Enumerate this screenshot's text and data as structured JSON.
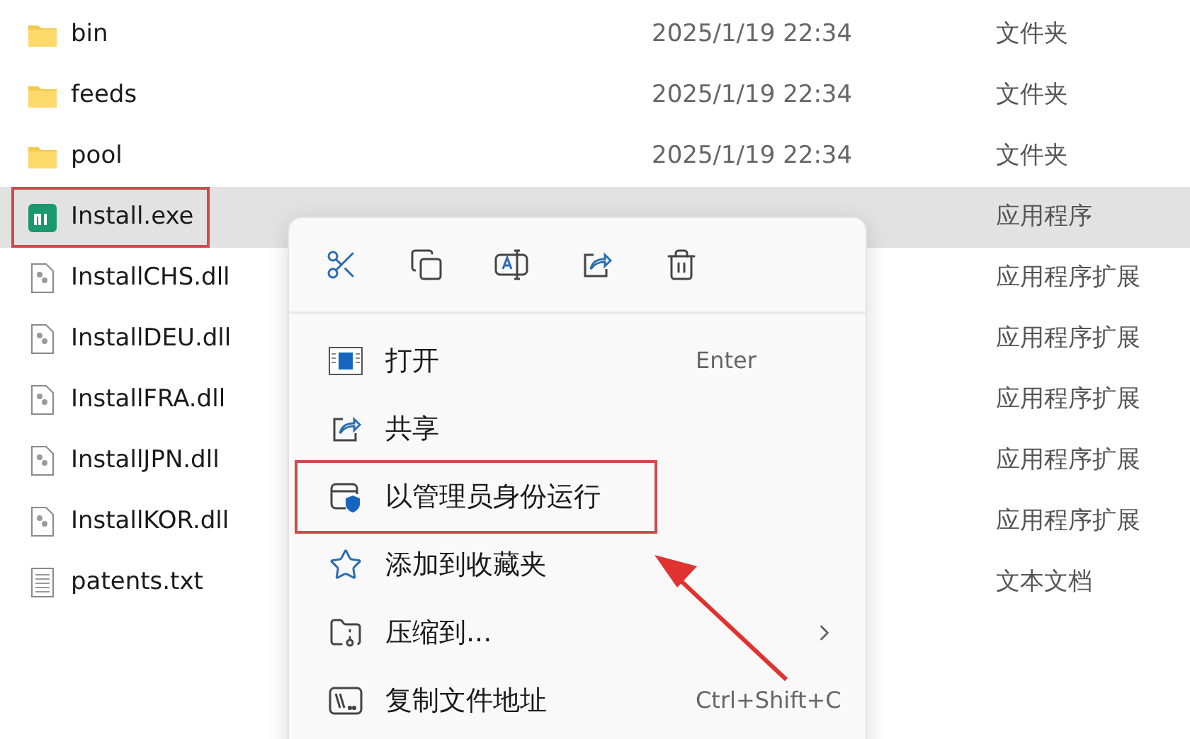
{
  "files": [
    {
      "kind": "folder",
      "name": "bin",
      "date": "2025/1/19 22:34",
      "type": "文件夹",
      "selected": false,
      "annotated": false
    },
    {
      "kind": "folder",
      "name": "feeds",
      "date": "2025/1/19 22:34",
      "type": "文件夹",
      "selected": false,
      "annotated": false
    },
    {
      "kind": "folder",
      "name": "pool",
      "date": "2025/1/19 22:34",
      "type": "文件夹",
      "selected": false,
      "annotated": false
    },
    {
      "kind": "exe",
      "name": "Install.exe",
      "type": "应用程序",
      "selected": true,
      "annotated": true
    },
    {
      "kind": "dll",
      "name": "InstallCHS.dll",
      "type": "应用程序扩展",
      "selected": false,
      "annotated": false
    },
    {
      "kind": "dll",
      "name": "InstallDEU.dll",
      "type": "应用程序扩展",
      "selected": false,
      "annotated": false
    },
    {
      "kind": "dll",
      "name": "InstallFRA.dll",
      "type": "应用程序扩展",
      "selected": false,
      "annotated": false
    },
    {
      "kind": "dll",
      "name": "InstallJPN.dll",
      "type": "应用程序扩展",
      "selected": false,
      "annotated": false
    },
    {
      "kind": "dll",
      "name": "InstallKOR.dll",
      "type": "应用程序扩展",
      "selected": false,
      "annotated": false
    },
    {
      "kind": "txt",
      "name": "patents.txt",
      "type": "文本文档",
      "selected": false,
      "annotated": false
    }
  ],
  "context_menu": {
    "toolbar": [
      {
        "kind": "cut"
      },
      {
        "kind": "copy"
      },
      {
        "kind": "rename"
      },
      {
        "kind": "share"
      },
      {
        "kind": "delete"
      }
    ],
    "items": [
      {
        "kind": "open",
        "label": "打开",
        "shortcut": "Enter",
        "submenu": false,
        "annotated": false
      },
      {
        "kind": "share",
        "label": "共享",
        "submenu": false,
        "annotated": false
      },
      {
        "kind": "admin",
        "label": "以管理员身份运行",
        "submenu": false,
        "annotated": true
      },
      {
        "kind": "favorite",
        "label": "添加到收藏夹",
        "submenu": false,
        "annotated": false
      },
      {
        "kind": "compress",
        "label": "压缩到...",
        "submenu": true,
        "annotated": false
      },
      {
        "kind": "copy_path",
        "label": "复制文件地址",
        "shortcut": "Ctrl+Shift+C",
        "submenu": false,
        "annotated": false
      }
    ]
  }
}
